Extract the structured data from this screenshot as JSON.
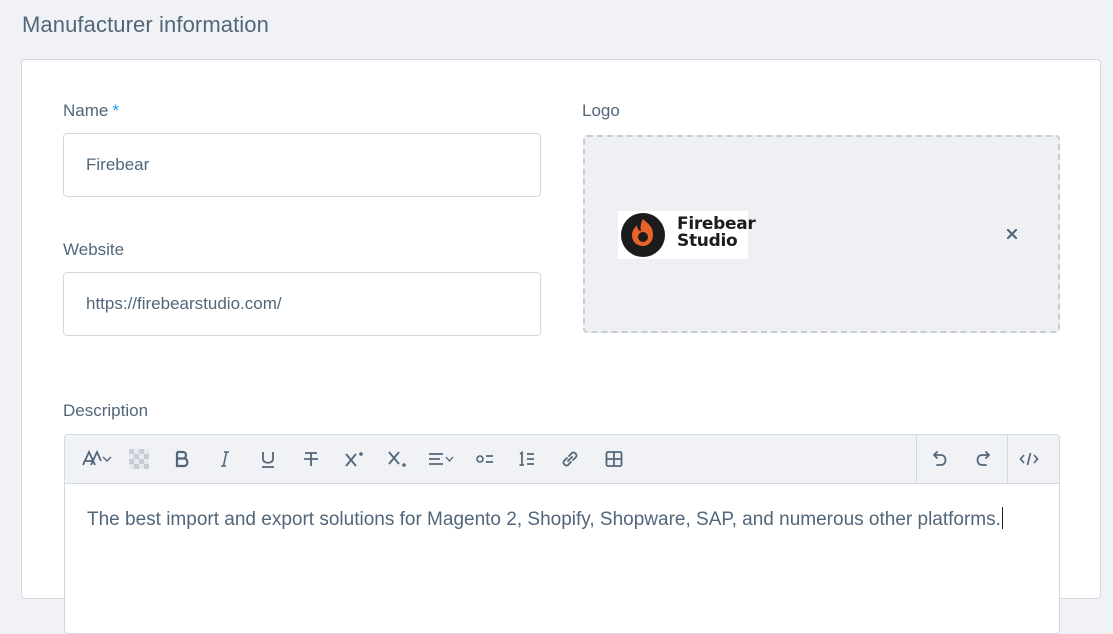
{
  "section": {
    "title": "Manufacturer information"
  },
  "form": {
    "name_label": "Name",
    "required_marker": "*",
    "name_value": "Firebear",
    "website_label": "Website",
    "website_value": "https://firebearstudio.com/",
    "logo_label": "Logo",
    "logo_text_line1": "Firebear",
    "logo_text_line2": "Studio",
    "description_label": "Description",
    "description_value": "The best import and export solutions for Magento 2, Shopify, Shopware, SAP, and numerous other platforms."
  },
  "toolbar": {
    "icons": [
      "text-style-icon",
      "highlight-icon",
      "bold-icon",
      "italic-icon",
      "underline-icon",
      "strikethrough-icon",
      "superscript-icon",
      "subscript-icon",
      "align-icon",
      "bullet-list-icon",
      "numbered-list-icon",
      "link-icon",
      "table-icon",
      "undo-icon",
      "redo-icon",
      "code-view-icon"
    ]
  },
  "colors": {
    "accent": "#189eff",
    "text": "#52667a",
    "border": "#d1d9e2",
    "logo_flame": "#e8642c"
  }
}
